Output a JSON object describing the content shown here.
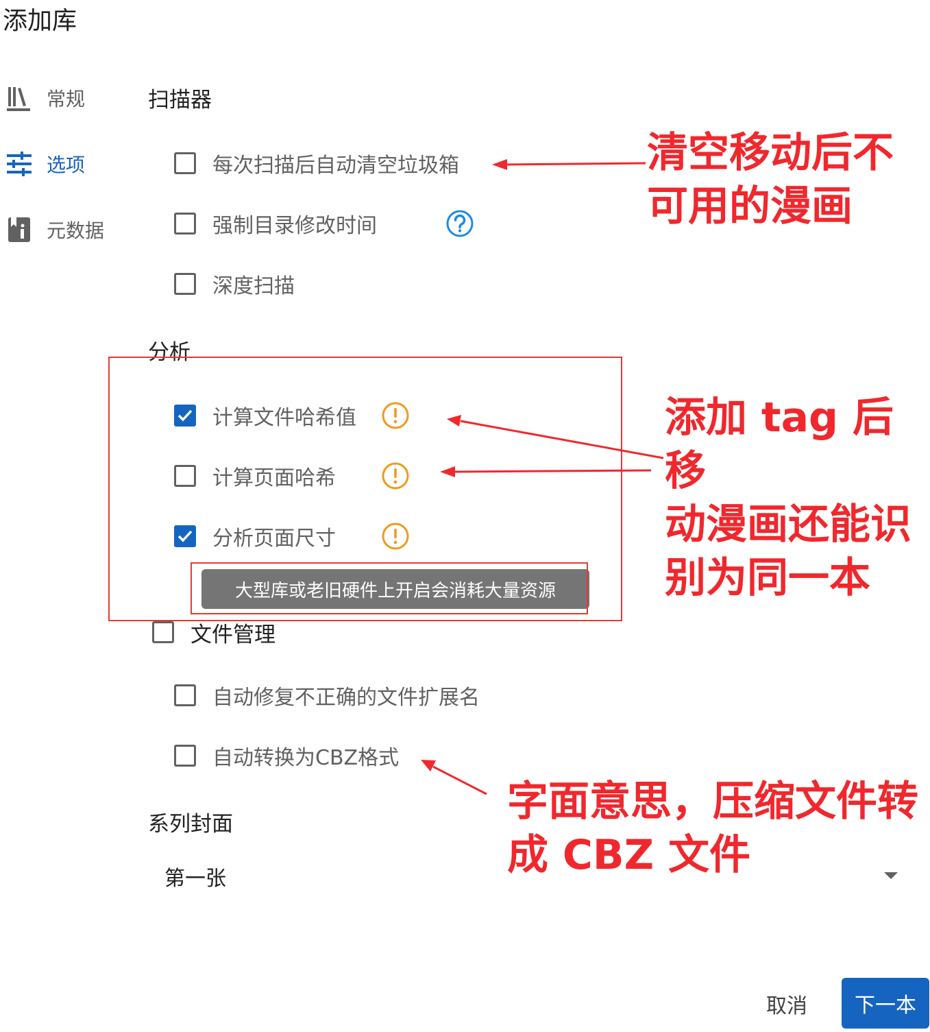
{
  "dialog": {
    "title": "添加库"
  },
  "sidebar": {
    "items": [
      {
        "label": "常规",
        "icon": "library-books-icon",
        "active": false
      },
      {
        "label": "选项",
        "icon": "tune-icon",
        "active": true
      },
      {
        "label": "元数据",
        "icon": "book-info-icon",
        "active": false
      }
    ]
  },
  "scanner": {
    "title": "扫描器",
    "options": [
      {
        "label": "每次扫描后自动清空垃圾箱",
        "checked": false
      },
      {
        "label": "强制目录修改时间",
        "checked": false
      },
      {
        "label": "深度扫描",
        "checked": false
      }
    ]
  },
  "analysis": {
    "title": "分析",
    "options": [
      {
        "label": "计算文件哈希值",
        "checked": true
      },
      {
        "label": "计算页面哈希",
        "checked": false
      },
      {
        "label": "分析页面尺寸",
        "checked": true
      }
    ],
    "tooltip": "大型库或老旧硬件上开启会消耗大量资源"
  },
  "file_management": {
    "title": "文件管理",
    "checked": false,
    "options": [
      {
        "label": "自动修复不正确的文件扩展名",
        "checked": false
      },
      {
        "label": "自动转换为CBZ格式",
        "checked": false
      }
    ]
  },
  "series_cover": {
    "title": "系列封面",
    "selected": "第一张"
  },
  "buttons": {
    "cancel": "取消",
    "next": "下一本"
  },
  "annotations": {
    "empty_trash": [
      "清空移动后不",
      "可用的漫画"
    ],
    "hash": [
      "添加 tag 后移",
      "动漫画还能识",
      "别为同一本"
    ],
    "cbz": [
      "字面意思，压缩文件转",
      "成 CBZ 文件"
    ]
  },
  "colors": {
    "accent": "#1565c0",
    "warning": "#f09a1a",
    "help": "#1e88e5",
    "annotation": "#f0282d"
  }
}
